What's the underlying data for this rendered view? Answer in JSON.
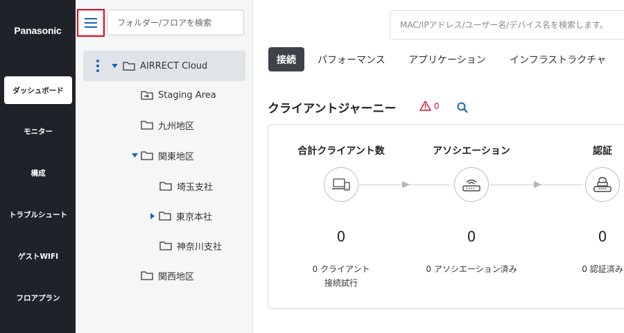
{
  "nav": {
    "brand": "Panasonic",
    "items": [
      {
        "label": "ダッシュボード",
        "active": true
      },
      {
        "label": "モニター",
        "active": false
      },
      {
        "label": "構成",
        "active": false
      },
      {
        "label": "トラブルシュート",
        "active": false
      },
      {
        "label": "ゲストWIFI",
        "active": false
      },
      {
        "label": "フロアプラン",
        "active": false
      }
    ]
  },
  "folder_panel": {
    "search_placeholder": "フォルダー/フロアを検索",
    "tree": {
      "root": "AIRRECT Cloud",
      "items": [
        {
          "label": "Staging Area"
        },
        {
          "label": "九州地区"
        },
        {
          "label": "関東地区"
        },
        {
          "label": "埼玉支社"
        },
        {
          "label": "東京本社"
        },
        {
          "label": "神奈川支社"
        },
        {
          "label": "関西地区"
        }
      ]
    }
  },
  "header": {
    "search_placeholder": "MAC/IPアドレス/ユーザー名/デバイス名を検索します。"
  },
  "tabs": [
    {
      "label": "接続",
      "active": true
    },
    {
      "label": "パフォーマンス",
      "active": false
    },
    {
      "label": "アプリケーション",
      "active": false
    },
    {
      "label": "インフラストラクチャ",
      "active": false
    }
  ],
  "journey": {
    "title": "クライアントジャーニー",
    "alert_count": "0",
    "stages": [
      {
        "title": "合計クライアント数",
        "value": "0",
        "desc_line1": "0 クライアント",
        "desc_line2": "接続試行"
      },
      {
        "title": "アソシエーション",
        "value": "0",
        "desc_line1": "0 アソシエーション済み",
        "desc_line2": ""
      },
      {
        "title": "認証",
        "value": "0",
        "desc_line1": "0 認証済み",
        "desc_line2": ""
      }
    ]
  },
  "colors": {
    "nav_bg": "#1f2229",
    "accent_blue": "#1565c0",
    "alert_red": "#d4112a",
    "highlight_border": "#e60012",
    "active_tab": "#3e434a"
  }
}
